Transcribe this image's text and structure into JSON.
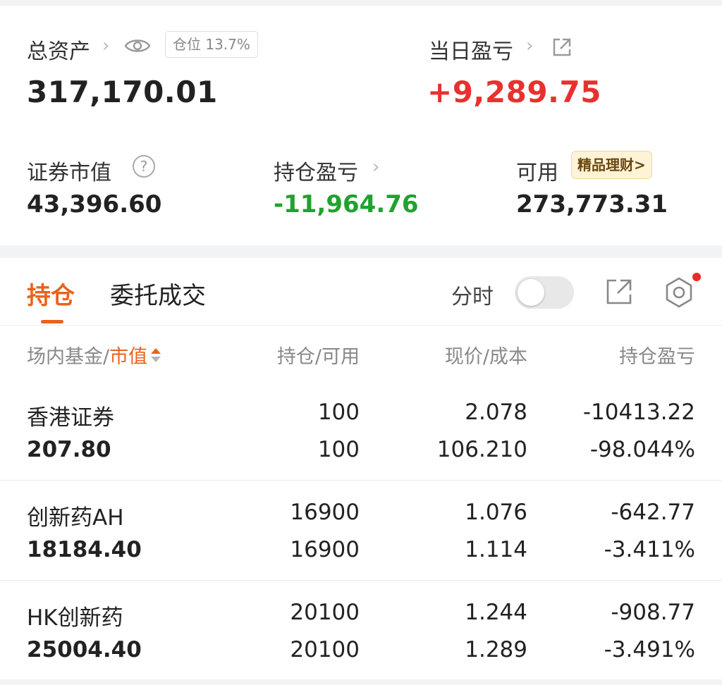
{
  "summary": {
    "total_assets_label": "总资产",
    "total_assets_value": "317,170.01",
    "position_ratio": "仓位 13.7%",
    "daily_pnl_label": "当日盈亏",
    "daily_pnl_value": "+9,289.75",
    "market_value_label": "证券市值",
    "market_value": "43,396.60",
    "position_pnl_label": "持仓盈亏",
    "position_pnl_value": "-11,964.76",
    "available_label": "可用",
    "available_value": "273,773.31",
    "wealth_chip": "精品理财>"
  },
  "tabs": {
    "holdings": "持仓",
    "orders": "委托成交",
    "time_share_label": "分时"
  },
  "table": {
    "headers": {
      "name_prefix": "场内基金/",
      "name_sort": "市值",
      "holding": "持仓/可用",
      "price": "现价/成本",
      "pnl": "持仓盈亏"
    },
    "rows": [
      {
        "name": "香港证券",
        "market_value": "207.80",
        "holding": "100",
        "available": "100",
        "price": "2.078",
        "cost": "106.210",
        "pnl": "-10413.22",
        "pnl_pct": "-98.044%"
      },
      {
        "name": "创新药AH",
        "market_value": "18184.40",
        "holding": "16900",
        "available": "16900",
        "price": "1.076",
        "cost": "1.114",
        "pnl": "-642.77",
        "pnl_pct": "-3.411%"
      },
      {
        "name": "HK创新药",
        "market_value": "25004.40",
        "holding": "20100",
        "available": "20100",
        "price": "1.244",
        "cost": "1.289",
        "pnl": "-908.77",
        "pnl_pct": "-3.491%"
      }
    ]
  },
  "colors": {
    "accent": "#e8631c",
    "profit": "#e8312f",
    "loss": "#1fa22e"
  },
  "icons": [
    "chevron-right-icon",
    "eye-icon",
    "external-link-icon",
    "help-icon",
    "settings-icon",
    "sort-icon"
  ]
}
